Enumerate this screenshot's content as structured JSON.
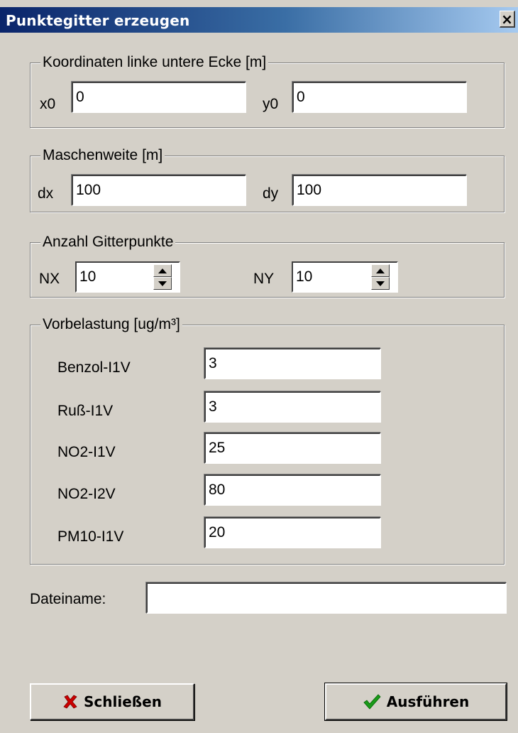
{
  "window": {
    "title": "Punktegitter erzeugen",
    "close_glyph": "×"
  },
  "origin": {
    "legend": "Koordinaten linke untere Ecke [m]",
    "x0_label": "x0",
    "x0_value": "0",
    "y0_label": "y0",
    "y0_value": "0"
  },
  "mesh": {
    "legend": "Maschenweite [m]",
    "dx_label": "dx",
    "dx_value": "100",
    "dy_label": "dy",
    "dy_value": "100"
  },
  "gridpoints": {
    "legend": "Anzahl Gitterpunkte",
    "nx_label": "NX",
    "nx_value": "10",
    "ny_label": "NY",
    "ny_value": "10"
  },
  "background_load": {
    "legend": "Vorbelastung [ug/m³]",
    "items": [
      {
        "label": "Benzol-I1V",
        "value": "3"
      },
      {
        "label": "Ruß-I1V",
        "value": "3"
      },
      {
        "label": "NO2-I1V",
        "value": "25"
      },
      {
        "label": "NO2-I2V",
        "value": "80"
      },
      {
        "label": "PM10-I1V",
        "value": "20"
      }
    ]
  },
  "filename": {
    "label": "Dateiname:",
    "value": ""
  },
  "buttons": {
    "close_label": "Schließen",
    "close_icon": "red-x-icon",
    "close_color": "#cc0000",
    "run_label": "Ausführen",
    "run_icon": "green-checkmark-icon",
    "run_color": "#008000"
  }
}
